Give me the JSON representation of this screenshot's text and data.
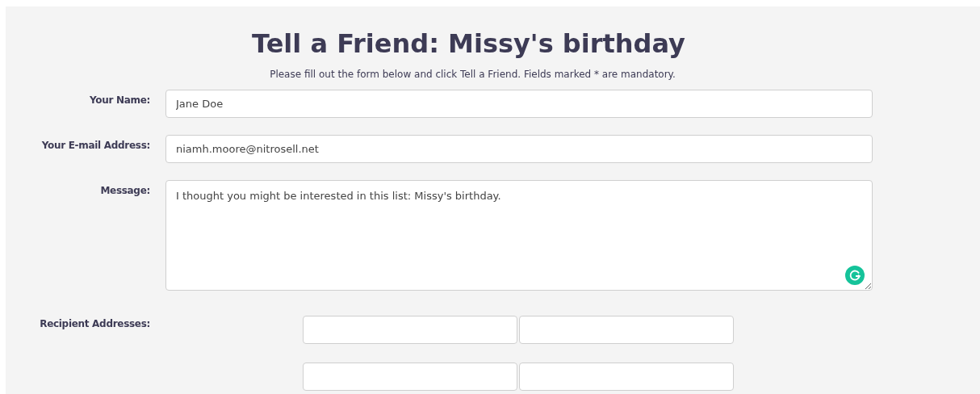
{
  "title": "Tell a Friend: Missy's birthday",
  "instructions": "Please fill out the form below and click Tell a Friend. Fields marked * are mandatory.",
  "fields": [
    {
      "label": "Your Name:",
      "kind": "text",
      "value": "Jane Doe"
    },
    {
      "label": "Your E-mail Address:",
      "kind": "text",
      "value": "niamh.moore@nitrosell.net"
    },
    {
      "label": "Message:",
      "kind": "textarea",
      "value": "I thought you might be interested in this list: Missy's birthday."
    }
  ],
  "recipients": {
    "label": "Recipient Addresses:",
    "fields": [
      {
        "kind": "email"
      },
      {
        "kind": "email"
      },
      {
        "kind": "email"
      },
      {
        "kind": "email"
      }
    ]
  }
}
